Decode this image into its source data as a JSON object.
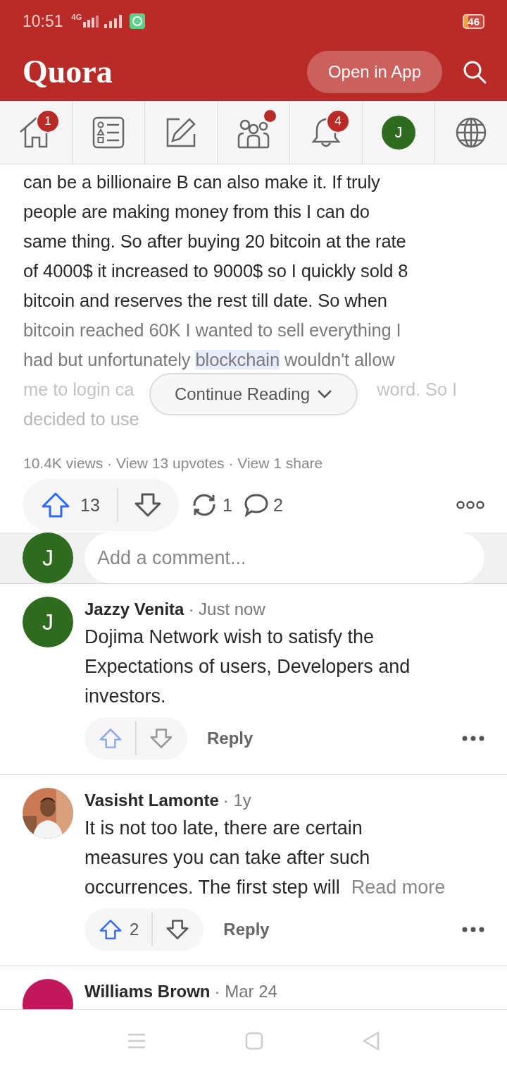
{
  "status_bar": {
    "time": "10:51",
    "network": "4G",
    "battery": "46"
  },
  "header": {
    "logo": "Quora",
    "open_app": "Open in App"
  },
  "nav": [
    {
      "kind": "home",
      "badge": "1",
      "dot": false
    },
    {
      "kind": "list",
      "dot": false
    },
    {
      "kind": "edit",
      "dot": false
    },
    {
      "kind": "people",
      "dot": true
    },
    {
      "kind": "bell",
      "badge": "4",
      "dot": false
    },
    {
      "kind": "avatar",
      "initial": "J",
      "dot": false
    },
    {
      "kind": "globe",
      "dot": false
    }
  ],
  "article": {
    "lines": [
      {
        "kind": "full",
        "text": "can be a billionaire B can also make it. If truly"
      },
      {
        "kind": "full",
        "text": "people are making money from this I can do"
      },
      {
        "kind": "full",
        "text": "same thing. So after buying 20 bitcoin at the rate"
      },
      {
        "kind": "full",
        "text": "of 4000$ it increased to 9000$ so I quickly sold 8"
      },
      {
        "kind": "full",
        "text": "bitcoin and reserves the rest till date. So when"
      },
      {
        "kind": "fading",
        "text": "bitcoin reached 60K I wanted to sell everything I"
      },
      {
        "kind": "fading",
        "text": "had but unfortunately ",
        "selection": "blockchain",
        "rest": " wouldn't allow"
      },
      {
        "kind": "faint",
        "text": "me to login ca",
        "rest": "word. So I"
      },
      {
        "kind": "faintest",
        "text": "decided to use"
      }
    ],
    "continue": "Continue Reading",
    "stats": "10.4K views · View 13 upvotes · View 1 share",
    "upvotes": "13",
    "upvoted": false,
    "shares": "1",
    "comments": "2"
  },
  "comment_box": {
    "initial": "J",
    "placeholder": "Add a comment..."
  },
  "comments": [
    {
      "kind": "initial",
      "initial": "J",
      "color": "#2e6b1f",
      "author": "Jazzy Venita",
      "time": "· Just now",
      "lines": [
        "Dojima Network wish to satisfy the",
        "Expectations of users, Developers and",
        "investors."
      ],
      "reply": "Reply"
    },
    {
      "author": "Vasisht Lamonte",
      "time": "· 1y",
      "lines": [
        "It is not too late, there are certain",
        "measures you can take after such",
        "occurrences. The first step will"
      ],
      "more": "Read more",
      "upvotes": "2",
      "reply": "Reply"
    },
    {
      "kind": "initial",
      "color": "#c2185b",
      "author": "Williams Brown",
      "time": "· Mar 24"
    }
  ]
}
